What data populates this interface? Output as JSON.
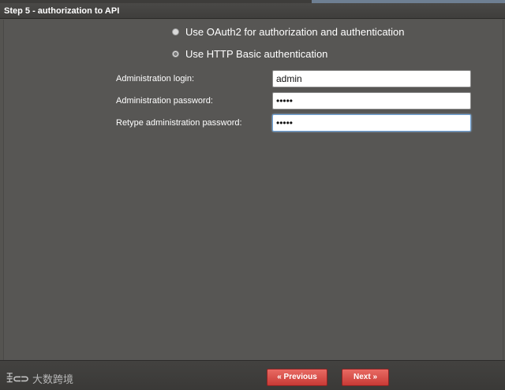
{
  "header": {
    "title": "Step 5 - authorization to API"
  },
  "auth_options": [
    {
      "label": "Use OAuth2 for authorization and authentication",
      "selected": false
    },
    {
      "label": "Use HTTP Basic authentication",
      "selected": true
    }
  ],
  "form": {
    "login_label": "Administration login:",
    "login_value": "admin",
    "password_label": "Administration password:",
    "password_value": "•••••",
    "retype_label": "Retype administration password:",
    "retype_value": "•••••"
  },
  "footer": {
    "previous_label": "« Previous",
    "next_label": "Next »"
  },
  "watermark": {
    "logo": "ꀨ⊂⊃",
    "text": "大数跨境"
  },
  "colors": {
    "button": "#d94a44",
    "header_bg": "#3f3e3c",
    "panel_bg": "#575654"
  }
}
